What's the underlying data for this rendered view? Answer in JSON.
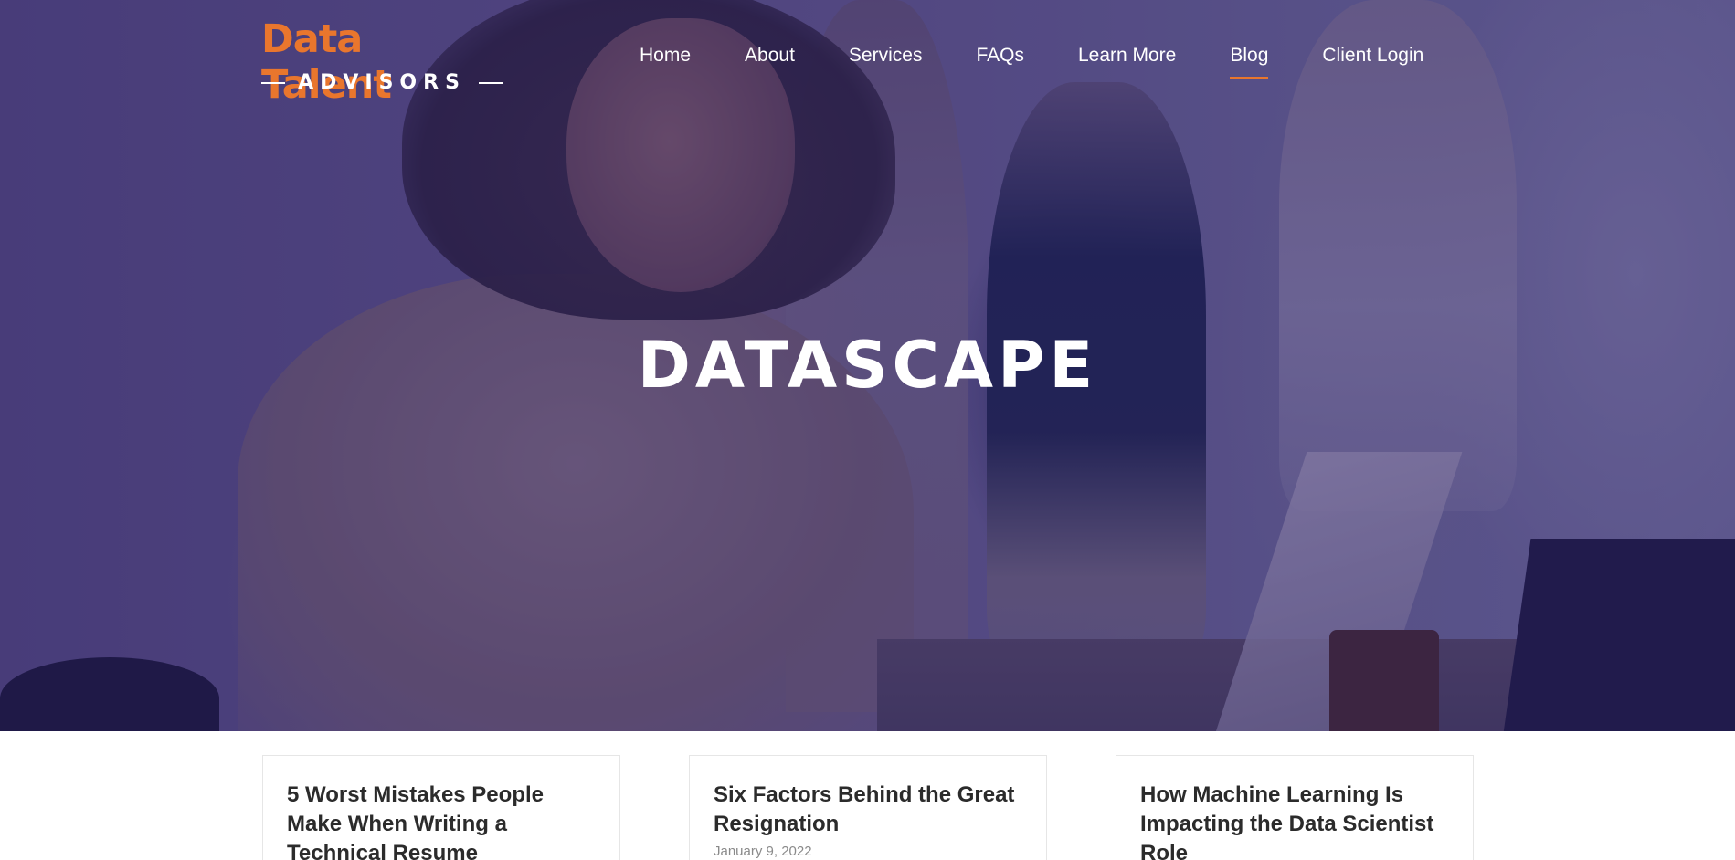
{
  "logo": {
    "title": "Data Talent",
    "subtitle": "ADVISORS"
  },
  "nav": {
    "items": [
      {
        "label": "Home"
      },
      {
        "label": "About"
      },
      {
        "label": "Services"
      },
      {
        "label": "FAQs"
      },
      {
        "label": "Learn More"
      },
      {
        "label": "Blog"
      },
      {
        "label": "Client Login"
      }
    ],
    "active": "Blog"
  },
  "hero": {
    "title": "DATASCAPE"
  },
  "posts": [
    {
      "title": "5 Worst Mistakes People Make When Writing a Technical Resume",
      "date": ""
    },
    {
      "title": "Six Factors Behind the Great Resignation",
      "date": "January 9, 2022"
    },
    {
      "title": "How Machine Learning Is Impacting the Data Scientist Role",
      "date": ""
    }
  ],
  "colors": {
    "accent": "#e9762d",
    "hero_overlay": "#281c60",
    "text_dark": "#2b2b2b"
  }
}
